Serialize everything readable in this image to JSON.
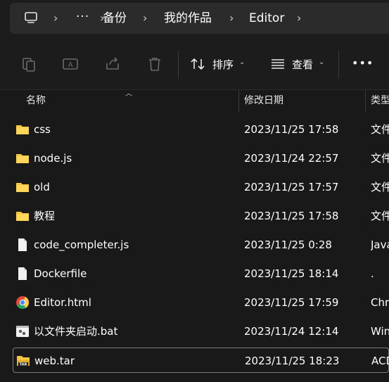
{
  "address": {
    "crumbs": [
      "备份",
      "我的作品",
      "Editor"
    ],
    "overflow": "···"
  },
  "toolbar": {
    "sort_label": "排序",
    "view_label": "查看",
    "more_label": "•••"
  },
  "columns": {
    "name": "名称",
    "modified": "修改日期",
    "type": "类型"
  },
  "files": [
    {
      "name": "css",
      "date": "2023/11/25 17:58",
      "type": "文件夹",
      "icon": "folder-icon"
    },
    {
      "name": "node.js",
      "date": "2023/11/24 22:57",
      "type": "文件夹",
      "icon": "folder-icon"
    },
    {
      "name": "old",
      "date": "2023/11/25 17:57",
      "type": "文件夹",
      "icon": "folder-icon"
    },
    {
      "name": "教程",
      "date": "2023/11/25 17:58",
      "type": "文件夹",
      "icon": "folder-icon"
    },
    {
      "name": "code_completer.js",
      "date": "2023/11/25 0:28",
      "type": "JavaScript",
      "icon": "file-icon"
    },
    {
      "name": "Dockerfile",
      "date": "2023/11/25 18:14",
      "type": ".",
      "icon": "file-icon"
    },
    {
      "name": "Editor.html",
      "date": "2023/11/25 17:59",
      "type": "Chrome",
      "icon": "chrome-icon"
    },
    {
      "name": "以文件夹启动.bat",
      "date": "2023/11/24 12:14",
      "type": "Windows",
      "icon": "bat-icon"
    },
    {
      "name": "web.tar",
      "date": "2023/11/25 18:23",
      "type": "ACDSee",
      "icon": "tar-icon"
    }
  ],
  "colors": {
    "background": "#191919",
    "folder": "#f5c542",
    "selection_border": "#7a7a7a"
  }
}
